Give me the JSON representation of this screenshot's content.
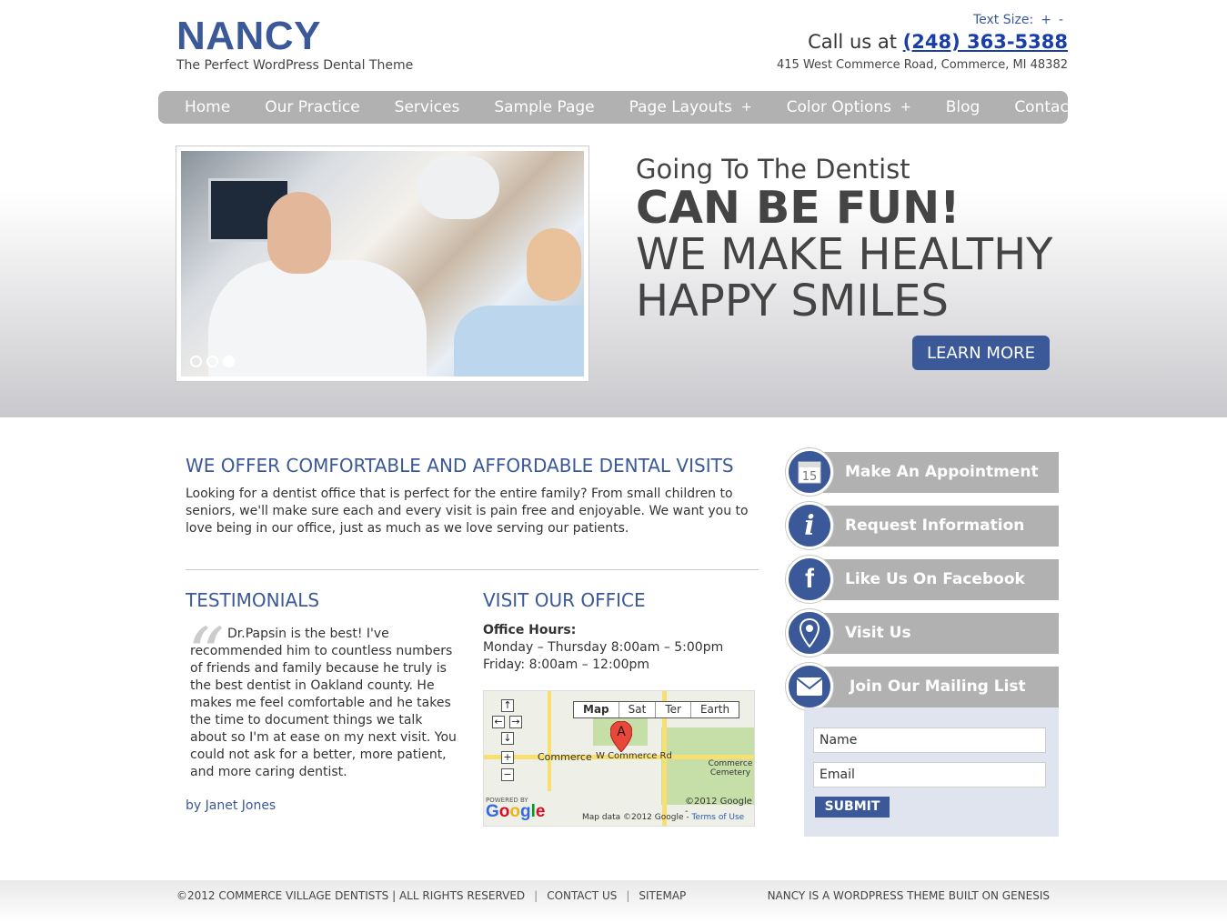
{
  "header": {
    "site_title": "NANCY",
    "tagline": "The Perfect WordPress Dental Theme",
    "text_size_label": "Text Size:",
    "text_size_increase": "+",
    "text_size_decrease": "-",
    "call_label": "Call us at",
    "phone": "(248) 363-5388",
    "address": "415 West Commerce Road, Commerce, MI 48382"
  },
  "nav": {
    "items": [
      {
        "label": "Home"
      },
      {
        "label": "Our Practice"
      },
      {
        "label": "Services"
      },
      {
        "label": "Sample Page"
      },
      {
        "label": "Page Layouts",
        "submenu": "+"
      },
      {
        "label": "Color Options",
        "submenu": "+"
      },
      {
        "label": "Blog"
      },
      {
        "label": "Contact Us"
      }
    ]
  },
  "hero": {
    "line1": "Going To The Dentist",
    "line2": "CAN BE FUN!",
    "line3": "WE MAKE HEALTHY",
    "line4": "HAPPY SMILES",
    "button": "LEARN MORE",
    "slide_count": 3,
    "active_slide": 3
  },
  "intro": {
    "heading": "WE OFFER COMFORTABLE AND AFFORDABLE DENTAL VISITS",
    "body": "Looking for a dentist office that is perfect for the entire family? From small children to seniors, we'll make sure each and every visit is pain free and enjoyable. We want you to love being in our office, just as much as we love serving our patients."
  },
  "testimonials": {
    "heading": "TESTIMONIALS",
    "quote": "Dr.Papsin is the best! I've recommended him to countless numbers of friends and family because he truly is the best dentist in Oakland county. He makes me feel comfortable and he takes the time to document things we talk about so I'm at ease on my next visit. You could not ask for a better, more patient, and more caring dentist.",
    "author": "by Janet Jones"
  },
  "visit": {
    "heading": "VISIT OUR OFFICE",
    "hours_label": "Office Hours:",
    "hours_line1": "Monday – Thursday 8:00am – 5:00pm",
    "hours_line2": "Friday: 8:00am – 12:00pm",
    "map": {
      "types": [
        "Map",
        "Sat",
        "Ter",
        "Earth"
      ],
      "marker": "A",
      "road_commerce": "Commerce",
      "road_w_commerce": "W Commerce Rd",
      "cemetery": "Commerce Cemetery",
      "copyright": "©2012 Google -",
      "powered_by": "POWERED BY",
      "google": "Google",
      "map_data": "Map data ©2012 Google -",
      "terms": "Terms of Use"
    }
  },
  "sidebar": {
    "items": [
      {
        "label": "Make An Appointment",
        "icon": "calendar-icon",
        "icon_text": "15"
      },
      {
        "label": "Request Information",
        "icon": "info-icon",
        "icon_text": "i"
      },
      {
        "label": "Like Us On Facebook",
        "icon": "facebook-icon",
        "icon_text": "f"
      },
      {
        "label": "Visit Us",
        "icon": "map-pin-icon"
      },
      {
        "label": "Join Our Mailing List",
        "icon": "envelope-icon"
      }
    ],
    "mailing": {
      "name_placeholder": "Name",
      "email_placeholder": "Email",
      "submit": "SUBMIT"
    }
  },
  "footer": {
    "copyright": "©2012 COMMERCE VILLAGE DENTISTS | ALL RIGHTS RESERVED",
    "separator": "|",
    "contact": "CONTACT US",
    "sitemap": "SITEMAP",
    "credit": "NANCY IS A WORDPRESS THEME BUILT ON GENESIS"
  },
  "colors": {
    "brand_blue": "#3b5998",
    "nav_gray": "#b1b1b1",
    "phone_link": "#1a3ea8"
  }
}
